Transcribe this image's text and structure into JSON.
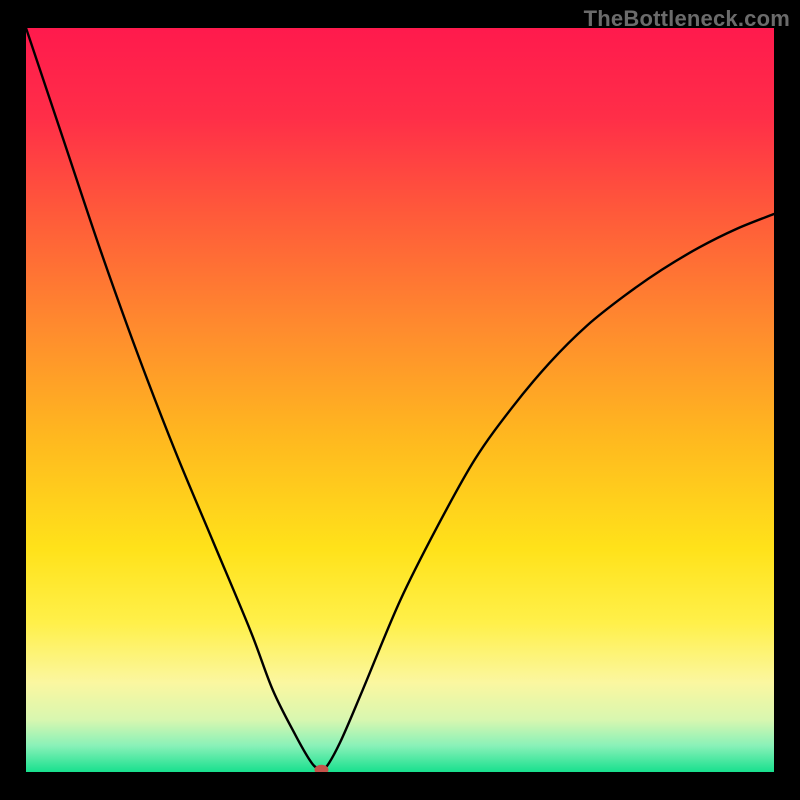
{
  "watermark": "TheBottleneck.com",
  "colors": {
    "frame": "#000000",
    "watermark": "#6b6b6b",
    "gradient_stops": [
      {
        "offset": 0.0,
        "color": "#ff1a4d"
      },
      {
        "offset": 0.12,
        "color": "#ff2e48"
      },
      {
        "offset": 0.25,
        "color": "#ff5a3a"
      },
      {
        "offset": 0.4,
        "color": "#ff8a2e"
      },
      {
        "offset": 0.55,
        "color": "#ffb81f"
      },
      {
        "offset": 0.7,
        "color": "#ffe21a"
      },
      {
        "offset": 0.8,
        "color": "#fff04a"
      },
      {
        "offset": 0.88,
        "color": "#fbf7a0"
      },
      {
        "offset": 0.93,
        "color": "#d8f7b0"
      },
      {
        "offset": 0.965,
        "color": "#88f1b8"
      },
      {
        "offset": 1.0,
        "color": "#18e08e"
      }
    ],
    "curve": "#000000",
    "marker_fill": "#c5524a"
  },
  "chart_data": {
    "type": "line",
    "title": "",
    "xlabel": "",
    "ylabel": "",
    "xlim": [
      0,
      100
    ],
    "ylim": [
      0,
      100
    ],
    "grid": false,
    "legend": false,
    "series": [
      {
        "name": "bottleneck-curve",
        "x": [
          0,
          5,
          10,
          15,
          20,
          25,
          30,
          33,
          36,
          38,
          39,
          40,
          42,
          45,
          50,
          55,
          60,
          65,
          70,
          75,
          80,
          85,
          90,
          95,
          100
        ],
        "y": [
          100,
          85,
          70,
          56,
          43,
          31,
          19,
          11,
          5,
          1.5,
          0.5,
          0.5,
          4,
          11,
          23,
          33,
          42,
          49,
          55,
          60,
          64,
          67.5,
          70.5,
          73,
          75
        ]
      }
    ],
    "marker": {
      "x": 39.5,
      "y": 0.3
    }
  }
}
